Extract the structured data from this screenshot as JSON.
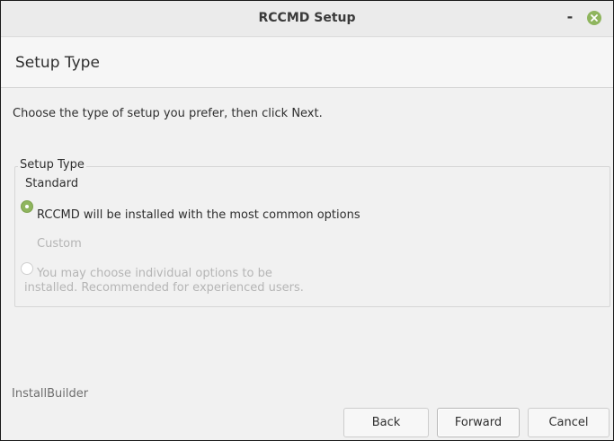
{
  "window": {
    "title": "RCCMD Setup",
    "minimize_glyph": "-",
    "close_icon": "close-icon",
    "accent_color": "#8fb55e"
  },
  "header": {
    "title": "Setup Type"
  },
  "instruction": "Choose the type of setup you prefer, then click Next.",
  "setup_group": {
    "legend": "Setup Type",
    "options": [
      {
        "title": "Standard",
        "description": "RCCMD will be installed with the most common options",
        "selected": true,
        "enabled": true
      },
      {
        "title": "Custom",
        "description_line1": "You may choose individual options to be",
        "description_line2": "installed. Recommended for experienced users.",
        "selected": false,
        "enabled": false
      }
    ]
  },
  "footer": {
    "brand": "InstallBuilder",
    "buttons": {
      "back": "Back",
      "forward": "Forward",
      "cancel": "Cancel"
    }
  }
}
